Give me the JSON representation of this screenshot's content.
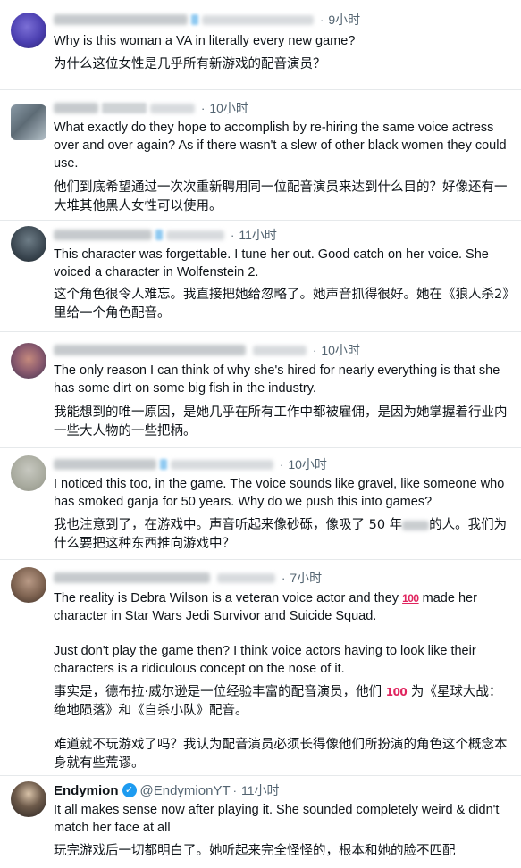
{
  "posts": [
    {
      "time": "9小时",
      "en": "Why is this woman a VA in literally every new game?",
      "zh": "为什么这位女性是几乎所有新游戏的配音演员？"
    },
    {
      "time": "10小时",
      "en": "What exactly do they hope to accomplish by re-hiring  the same voice actress over and over again? As if there wasn't a slew of other black women they could use.",
      "zh": "他们到底希望通过一次次重新聘用同一位配音演员来达到什么目的？好像还有一大堆其他黑人女性可以使用。"
    },
    {
      "time": "11小时",
      "en": "This character was forgettable. I tune her out. Good catch on her voice. She voiced a character in Wolfenstein 2.",
      "zh": "这个角色很令人难忘。我直接把她给忽略了。她声音抓得很好。她在《狼人杀2》里给一个角色配音。"
    },
    {
      "time": "10小时",
      "en": "The only reason I can think of why she's hired for nearly everything is that she has some dirt on some big fish in the industry.",
      "zh": "我能想到的唯一原因，是她几乎在所有工作中都被雇佣，是因为她掌握着行业内一些大人物的一些把柄。"
    },
    {
      "time": "10小时",
      "en": "I noticed this too, in the game. The voice sounds like gravel, like someone who has smoked ganja for 50 years. Why do we push this into games?",
      "zh_before": "我也注意到了，在游戏中。声音听起来像砂砾，像吸了 50 年",
      "zh_after": "的人。我们为什么要把这种东西推向游戏中？"
    },
    {
      "time": "7小时",
      "en_p1_before": "The reality is Debra Wilson is a veteran voice actor and they ",
      "emoji": "100",
      "en_p1_after": " made her character in Star Wars Jedi Survivor and Suicide Squad.",
      "en_p2": "Just don't play the game then? I think voice actors having to look like their characters is a ridiculous concept on the nose of it.",
      "zh_p1_before": "事实是，德布拉·威尔逊是一位经验丰富的配音演员，他们 ",
      "zh_p1_after": " 为《星球大战：绝地陨落》和《自杀小队》配音。",
      "zh_p2": "难道就不玩游戏了吗？我认为配音演员必须长得像他们所扮演的角色这个概念本身就有些荒谬。"
    },
    {
      "author": "Endymion",
      "handle": "@EndymionYT",
      "separator": "·",
      "time": "11小时",
      "en": "It all makes sense now after playing it. She sounded completely weird & didn't match her face at all",
      "zh": "玩完游戏后一切都明白了。她听起来完全怪怪的，根本和她的脸不匹配"
    }
  ],
  "colors": {
    "text": "#0f1419",
    "muted": "#536471",
    "verified": "#1d9bf0",
    "divider": "#e6e9eb"
  }
}
